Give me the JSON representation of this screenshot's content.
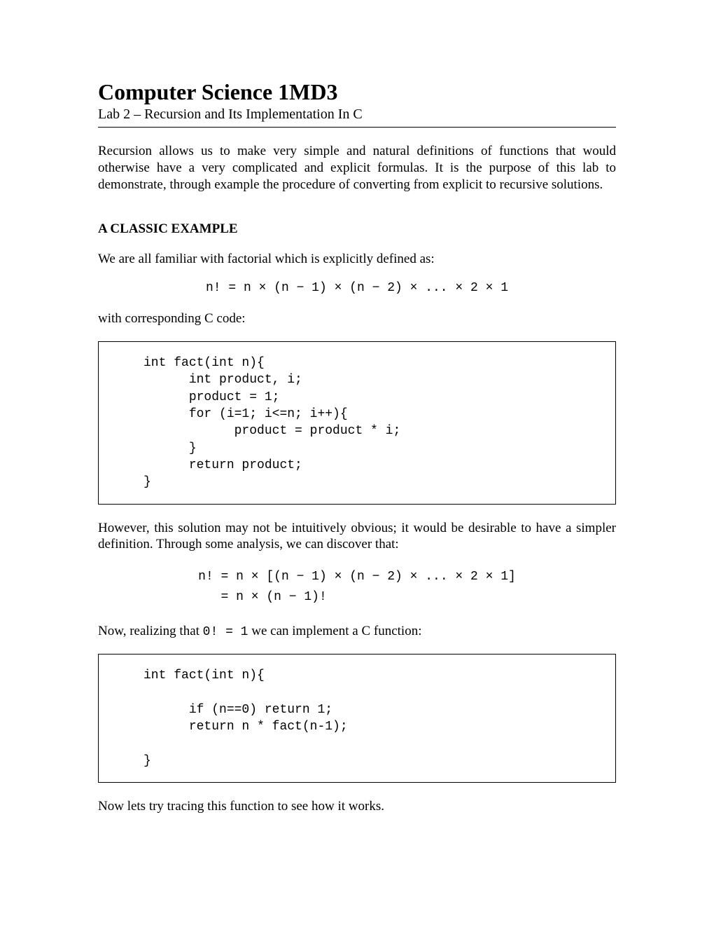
{
  "title": "Computer Science 1MD3",
  "subtitle": "Lab 2 – Recursion and Its Implementation In C",
  "intro": "Recursion allows us to make very simple and natural definitions of functions that would otherwise have a very complicated and explicit formulas. It is the purpose of this lab to demonstrate, through example the procedure of converting from explicit to recursive solutions.",
  "section1_heading": "A CLASSIC EXAMPLE",
  "section1_p1": "We are all familiar with factorial which is explicitly defined as:",
  "formula1": "n! = n × (n − 1) × (n − 2) × ... × 2 × 1",
  "section1_p2": "with corresponding C code:",
  "code1": "     int fact(int n){\n           int product, i;\n           product = 1;\n           for (i=1; i<=n; i++){\n                 product = product * i;\n           }\n           return product;\n     }",
  "section1_p3": "However, this solution may not be intuitively obvious; it would be desirable to have a simpler definition. Through some analysis, we can discover that:",
  "formula2_line1": "n! = n × [(n − 1) × (n − 2) × ... × 2 × 1]",
  "formula2_line2": "   = n × (n − 1)!",
  "section1_p4_a": "Now, realizing that ",
  "section1_p4_code": "0! = 1",
  "section1_p4_b": " we can implement a C function:",
  "code2": "     int fact(int n){\n\n           if (n==0) return 1;\n           return n * fact(n-1);\n\n     }",
  "section1_p5": "Now lets try tracing this function to see how it works."
}
